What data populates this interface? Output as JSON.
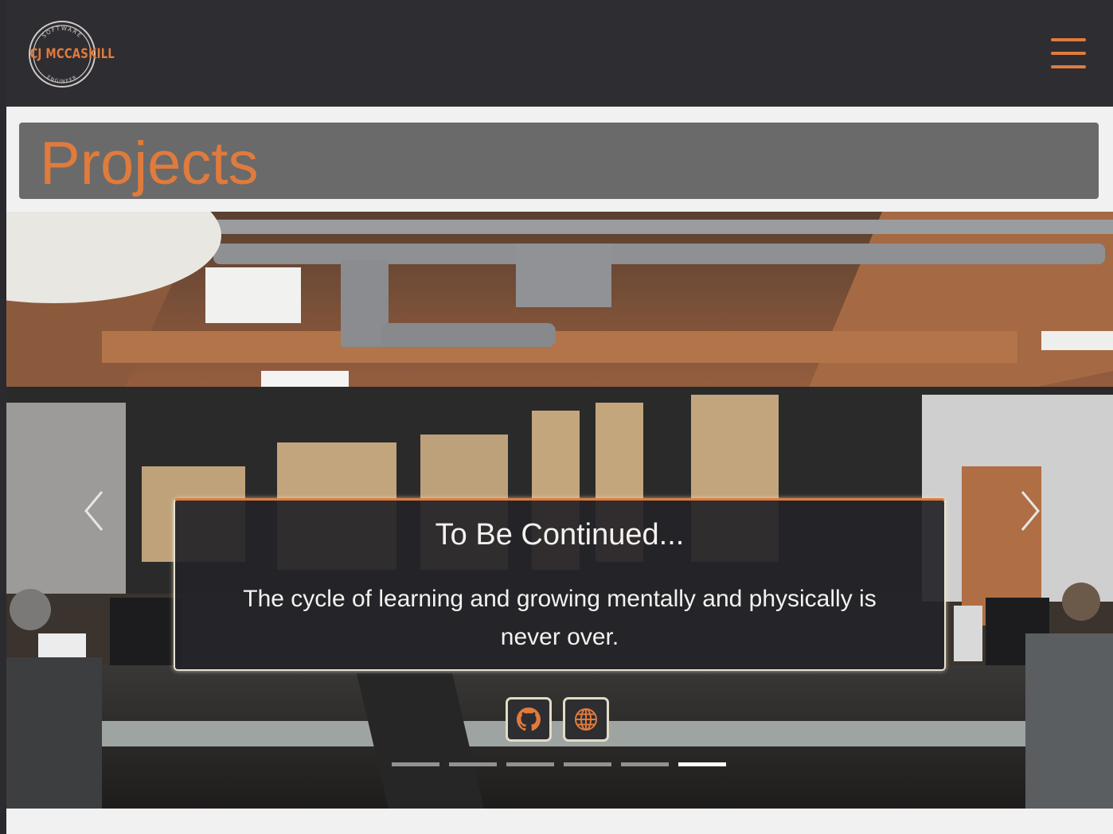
{
  "header": {
    "logo": {
      "name": "CJ MCCASKILL",
      "top_ring": "SOFTWARE",
      "bottom_ring": "ENGINEER"
    },
    "menu_icon": "hamburger-icon"
  },
  "main": {
    "title": "Projects"
  },
  "carousel": {
    "prev_icon": "chevron-left-icon",
    "next_icon": "chevron-right-icon",
    "active_slide": {
      "title": "To Be Continued...",
      "description": "The cycle of learning and growing mentally and physically is never over."
    },
    "buttons": [
      {
        "icon": "github-icon"
      },
      {
        "icon": "globe-icon"
      }
    ],
    "indicators": {
      "count": 6,
      "active_index": 5
    }
  },
  "colors": {
    "accent": "#e07b3c",
    "navbar": "#2e2d32",
    "title_bar": "#6a6a6b",
    "page_bg": "#f2f1f1"
  }
}
